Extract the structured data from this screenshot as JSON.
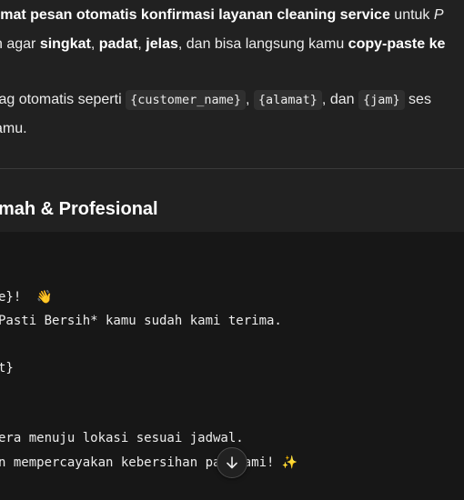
{
  "prose": {
    "line1": {
      "a": "rmat pesan otomatis konfirmasi layanan cleaning service",
      "b": " untuk ",
      "c": "P"
    },
    "line2": {
      "a": "n agar ",
      "b": "singkat",
      "c": ", ",
      "d": "padat",
      "e": ", ",
      "f": "jelas",
      "g": ", dan bisa langsung kamu ",
      "h": "copy-paste ke"
    },
    "line3": {
      "a": " tag otomatis seperti ",
      "tag1": "{customer_name}",
      "b": ", ",
      "tag2": "{alamat}",
      "c": ", dan ",
      "tag3": "{jam}",
      "d": " ses"
    },
    "line4": {
      "a": "amu."
    }
  },
  "heading": "mah & Profesional",
  "code": {
    "line1": "e}!  ",
    "line1_emoji": "👋",
    "line2": "Pasti Bersih* kamu sudah kami terima.",
    "line3": "t}",
    "line4": "era menuju lokasi sesuai jadwal.",
    "line5": "n mempercayakan kebersihan pa   ami! ",
    "line5_emoji": "✨"
  },
  "scroll_button": {
    "icon": "arrow-down-icon"
  },
  "colors": {
    "background": "#212121",
    "code_background": "#171717",
    "text": "#ececec",
    "inline_code_bg": "#2f2f2f"
  }
}
